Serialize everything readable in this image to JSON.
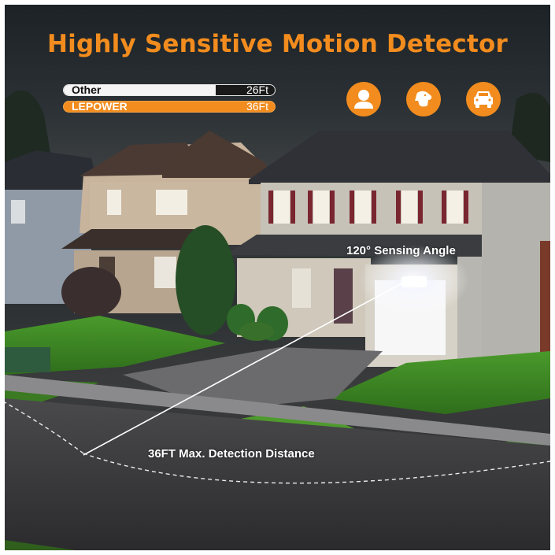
{
  "title": "Highly Sensitive Motion Detector",
  "comparison": {
    "other": {
      "label": "Other",
      "value": "26Ft",
      "fill_fraction": 0.72
    },
    "lepower": {
      "label": "LEPOWER",
      "value": "36Ft",
      "fill_fraction": 1.0
    }
  },
  "icons": [
    "person-icon",
    "dog-icon",
    "car-icon"
  ],
  "sensing_angle_label": "120° Sensing Angle",
  "detection_distance_label": "36FT Max. Detection Distance",
  "colors": {
    "accent": "#f28c1e"
  }
}
